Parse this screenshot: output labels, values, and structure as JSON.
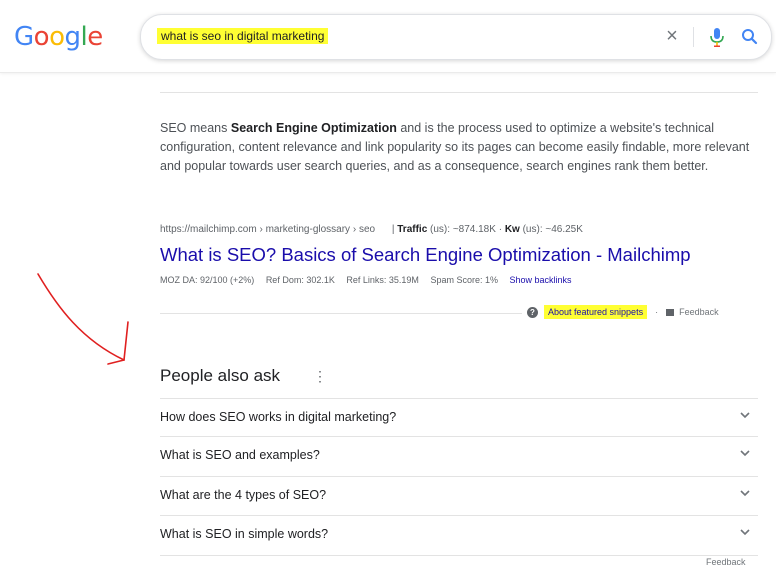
{
  "header": {
    "logo_letters": [
      {
        "ch": "G",
        "color": "#4285f4"
      },
      {
        "ch": "o",
        "color": "#ea4335"
      },
      {
        "ch": "o",
        "color": "#fbbc05"
      },
      {
        "ch": "g",
        "color": "#4285f4"
      },
      {
        "ch": "l",
        "color": "#34a853"
      },
      {
        "ch": "e",
        "color": "#ea4335"
      }
    ],
    "search_query": "what is seo in digital marketing",
    "clear_icon": "×"
  },
  "featured_snippet": {
    "text_pre": "SEO means ",
    "text_bold": "Search Engine Optimization",
    "text_post": " and is the process used to optimize a website's technical configuration, content relevance and link popularity so its pages can become easily findable, more relevant and popular towards user search queries, and as a consequence, search engines rank them better.",
    "cite_url": "https://mailchimp.com › marketing-glossary › seo",
    "traffic_label": "Traffic",
    "traffic_value": " (us): ~874.18K · ",
    "kw_label": "Kw",
    "kw_value": " (us): ~46.25K",
    "title": "What is SEO? Basics of Search Engine Optimization - Mailchimp",
    "metrics": [
      "MOZ DA: 92/100 (+2%)",
      "Ref Dom: 302.1K",
      "Ref Links: 35.19M",
      "Spam Score: 1%"
    ],
    "show_backlinks": "Show backlinks",
    "about_label": "About featured snippets",
    "dot": "·",
    "feedback_label": "Feedback"
  },
  "people_also_ask": {
    "title": "People also ask",
    "more_icon": "⋮",
    "questions": [
      "How does SEO works in digital marketing?",
      "What is SEO and examples?",
      "What are the 4 types of SEO?",
      "What is SEO in simple words?"
    ],
    "feedback_label": "Feedback"
  },
  "colors": {
    "link": "#1a0dab",
    "highlight": "#ffff33",
    "annotation_arrow": "#e02020"
  }
}
